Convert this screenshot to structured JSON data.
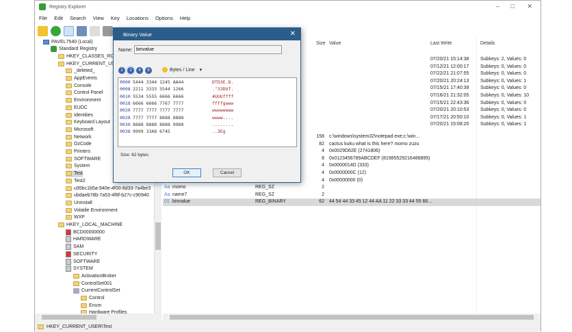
{
  "title": "Registry Explorer",
  "menu": [
    "File",
    "Edit",
    "Search",
    "View",
    "Key",
    "Locations",
    "Options",
    "Help"
  ],
  "tree": [
    {
      "label": "PAVEL7540 (Local)",
      "indent": 0,
      "icon": "computer"
    },
    {
      "label": "Standard Registry",
      "indent": 1,
      "icon": "registry"
    },
    {
      "label": "HKEY_CLASSES_ROO",
      "indent": 2,
      "icon": "folder"
    },
    {
      "label": "HKEY_CURRENT_USE",
      "indent": 2,
      "icon": "folder"
    },
    {
      "label": "_deleted_",
      "indent": 3,
      "icon": "folder"
    },
    {
      "label": "AppEvents",
      "indent": 3,
      "icon": "folder"
    },
    {
      "label": "Console",
      "indent": 3,
      "icon": "folder"
    },
    {
      "label": "Control Panel",
      "indent": 3,
      "icon": "folder"
    },
    {
      "label": "Environment",
      "indent": 3,
      "icon": "folder"
    },
    {
      "label": "EUDC",
      "indent": 3,
      "icon": "folder"
    },
    {
      "label": "Identities",
      "indent": 3,
      "icon": "folder"
    },
    {
      "label": "Keyboard Layout",
      "indent": 3,
      "icon": "folder"
    },
    {
      "label": "Microsoft",
      "indent": 3,
      "icon": "folder"
    },
    {
      "label": "Network",
      "indent": 3,
      "icon": "folder"
    },
    {
      "label": "OzCode",
      "indent": 3,
      "icon": "folder"
    },
    {
      "label": "Printers",
      "indent": 3,
      "icon": "folder"
    },
    {
      "label": "SOFTWARE",
      "indent": 3,
      "icon": "folder"
    },
    {
      "label": "System",
      "indent": 3,
      "icon": "folder"
    },
    {
      "label": "Test",
      "indent": 3,
      "icon": "folder",
      "selected": true
    },
    {
      "label": "Test2",
      "indent": 3,
      "icon": "folder"
    },
    {
      "label": "u95bc1b5a-940e-4f00-8d33-7a4be3",
      "indent": 3,
      "icon": "folder"
    },
    {
      "label": "ubdaeb78b-7a53-4f8f-b27c-c90940",
      "indent": 3,
      "icon": "folder"
    },
    {
      "label": "Uninstall",
      "indent": 3,
      "icon": "folder"
    },
    {
      "label": "Volatile Environment",
      "indent": 3,
      "icon": "folder"
    },
    {
      "label": "WXP",
      "indent": 3,
      "icon": "folder"
    },
    {
      "label": "HKEY_LOCAL_MACHINE",
      "indent": 2,
      "icon": "folder"
    },
    {
      "label": "BCD00000000",
      "indent": 3,
      "icon": "hive-locked"
    },
    {
      "label": "HARDWARE",
      "indent": 3,
      "icon": "hive"
    },
    {
      "label": "SAM",
      "indent": 3,
      "icon": "hive"
    },
    {
      "label": "SECURITY",
      "indent": 3,
      "icon": "hive-locked"
    },
    {
      "label": "SOFTWARE",
      "indent": 3,
      "icon": "hive"
    },
    {
      "label": "SYSTEM",
      "indent": 3,
      "icon": "hive"
    },
    {
      "label": "ActivationBroker",
      "indent": 4,
      "icon": "folder"
    },
    {
      "label": "ControlSet001",
      "indent": 4,
      "icon": "folder"
    },
    {
      "label": "CurrentControlSet",
      "indent": 4,
      "icon": "link"
    },
    {
      "label": "Control",
      "indent": 5,
      "icon": "folder"
    },
    {
      "label": "Enum",
      "indent": 5,
      "icon": "folder"
    },
    {
      "label": "Hardware Profiles",
      "indent": 5,
      "icon": "folder"
    }
  ],
  "columns": {
    "size": "Size",
    "value": "Value",
    "last_write": "Last Write",
    "details": "Details"
  },
  "keys": [
    {
      "last_write": "07/20/21 15:14:38",
      "details": "Subkeys: 2, Values: 0"
    },
    {
      "last_write": "07/12/21 12:00:17",
      "details": "Subkeys: 0, Values: 0"
    },
    {
      "last_write": "07/22/21 21:07:55",
      "details": "Subkeys: 0, Values: 0"
    },
    {
      "last_write": "07/20/21 20:24:13",
      "details": "Subkeys: 0, Values: 1"
    },
    {
      "last_write": "07/15/21 17:40:39",
      "details": "Subkeys: 0, Values: 0"
    },
    {
      "last_write": "07/16/21 21:32:05",
      "details": "Subkeys: 0, Values: 10"
    },
    {
      "last_write": "07/15/21 22:43:36",
      "details": "Subkeys: 0, Values: 0"
    },
    {
      "last_write": "07/20/21 20:10:53",
      "details": "Subkeys: 0, Values: 0"
    },
    {
      "last_write": "07/17/21 20:50:10",
      "details": "Subkeys: 0, Values: 1"
    },
    {
      "last_write": "07/20/21 15:08:20",
      "details": "Subkeys: 0, Values: 1"
    }
  ],
  "values": [
    {
      "name": "",
      "type": "",
      "size": "158",
      "value": "c:\\windows\\system32\\notepad.exe;c:\\win..."
    },
    {
      "name": "",
      "type": "",
      "size": "82",
      "value": "cactus kuku what is this here? momo zuzu"
    },
    {
      "name": "",
      "type": "",
      "size": "4",
      "value": "0x0029D62E (2741806)"
    },
    {
      "name": "",
      "type": "",
      "size": "8",
      "value": "0x0123456789ABCDEF (81985529216486895)"
    },
    {
      "name": "",
      "type": "",
      "size": "4",
      "value": "0x0000014D (333)"
    },
    {
      "name": "",
      "type": "",
      "size": "4",
      "value": "0x0000000C (12)"
    },
    {
      "name": "value4",
      "type": "REG_DWORD",
      "size": "4",
      "value": "0x00000000 (0)"
    },
    {
      "name": "momo",
      "type": "REG_SZ",
      "size": "2",
      "value": ""
    },
    {
      "name": "name7",
      "type": "REG_SZ",
      "size": "2",
      "value": ""
    },
    {
      "name": "binvalue",
      "type": "REG_BINARY",
      "size": "62",
      "value": "44 54 44 33 45 12 44 AA 11 22 33 33 44 55 66...",
      "selected": true
    }
  ],
  "status": "HKEY_CURRENT_USER\\Test",
  "dialog": {
    "title": "Binary Value",
    "name_label": "Name:",
    "name_value": "binvalue",
    "group_buttons": [
      "1",
      "2",
      "4",
      "8"
    ],
    "bytes_per_line": "Bytes / Line",
    "hex_rows": [
      {
        "offset": "0000",
        "hex": "5444 3344 1245 AA44",
        "ascii": "DTD3E.D."
      },
      {
        "offset": "0008",
        "hex": "2211 3333 5544 1266",
        "ascii": ".\"33DUf."
      },
      {
        "offset": "0010",
        "hex": "5534 5555 6666 6666",
        "ascii": "4UUUffff"
      },
      {
        "offset": "0018",
        "hex": "6666 6666 7767 7777",
        "ascii": "ffffgwww"
      },
      {
        "offset": "0020",
        "hex": "7777 7777 7777 7777",
        "ascii": "wwwwwwww"
      },
      {
        "offset": "0028",
        "hex": "7777 7777 8888 8888",
        "ascii": "wwww...."
      },
      {
        "offset": "0030",
        "hex": "8888 8888 8888 9988",
        "ascii": "........"
      },
      {
        "offset": "0038",
        "hex": "9999 33A8 6745",
        "ascii": "..3Eg"
      }
    ],
    "size_text": "Size: 62 bytes",
    "ok": "OK",
    "cancel": "Cancel"
  }
}
